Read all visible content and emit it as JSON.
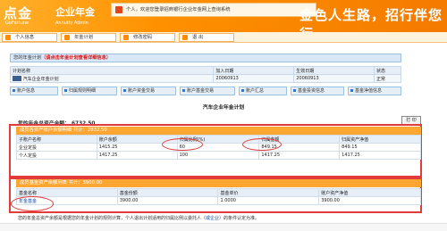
{
  "header": {
    "logo_zh": "点金",
    "logo_en": "GoFortune",
    "brand_zh": "企业年金",
    "brand_en": "Annuity Admin",
    "welcome": "个人，欢迎您登录招商银行企业年金网上查询系统",
    "slogan_1": "金色人生路，",
    "slogan_2": "招行伴您行"
  },
  "nav": [
    {
      "label": "个人信息"
    },
    {
      "label": "年金计划"
    },
    {
      "label": "修改密码"
    },
    {
      "label": "退  出"
    }
  ],
  "plan_section": {
    "title": "您的年金计划",
    "hint": "（请点击年金计划查看详细信息）",
    "headers": [
      "计划名称",
      "加入日期",
      "生效日期",
      "状态"
    ],
    "row": [
      "汽车企业年金计划",
      "20060913",
      "20060913",
      "正常"
    ]
  },
  "tabs": [
    {
      "label": "账户信息"
    },
    {
      "label": "归属规则明细"
    },
    {
      "label": "账户资金交易"
    },
    {
      "label": "账户基金交易"
    },
    {
      "label": "账户汇总"
    },
    {
      "label": "基金投资信息"
    },
    {
      "label": "基金净值信息"
    }
  ],
  "plan_subtitle": "汽车企业年金计划",
  "assets": {
    "label": "您的年金总资产余额：",
    "value": "6732.50"
  },
  "print_label": "打 印",
  "balance": {
    "title": "成员各资产账户余额明细 共计：2832.50",
    "headers": [
      "子账户名称",
      "账户余额",
      "归属比例(%)",
      "归属金额",
      "归属资产净值"
    ],
    "rows": [
      [
        "企业定投",
        "1415.25",
        "60",
        "849.15",
        "849.15"
      ],
      [
        "个人定投",
        "1417.25",
        "100",
        "1417.25",
        "1417.25"
      ]
    ]
  },
  "funds": {
    "title": "成员基金资产余额列表 共计：3900.00",
    "headers": [
      "基金名称",
      "基金份额",
      "基金单价",
      "账户资产净值"
    ],
    "rows": [
      [
        "年金基金",
        "3900.00",
        "1.0000",
        "3900.00"
      ]
    ]
  },
  "note": {
    "prefix": "您的年金总资产余额是根据您的年金计划的规则计算，个人退出计划适用的归属比例以委托人（",
    "highlight": "或企业",
    "suffix": "）的条件认定为准。"
  },
  "colors": {
    "brand_orange": "#ff9100",
    "highlight_red": "#e23b3b",
    "table_blue": "#d9e8f7"
  }
}
